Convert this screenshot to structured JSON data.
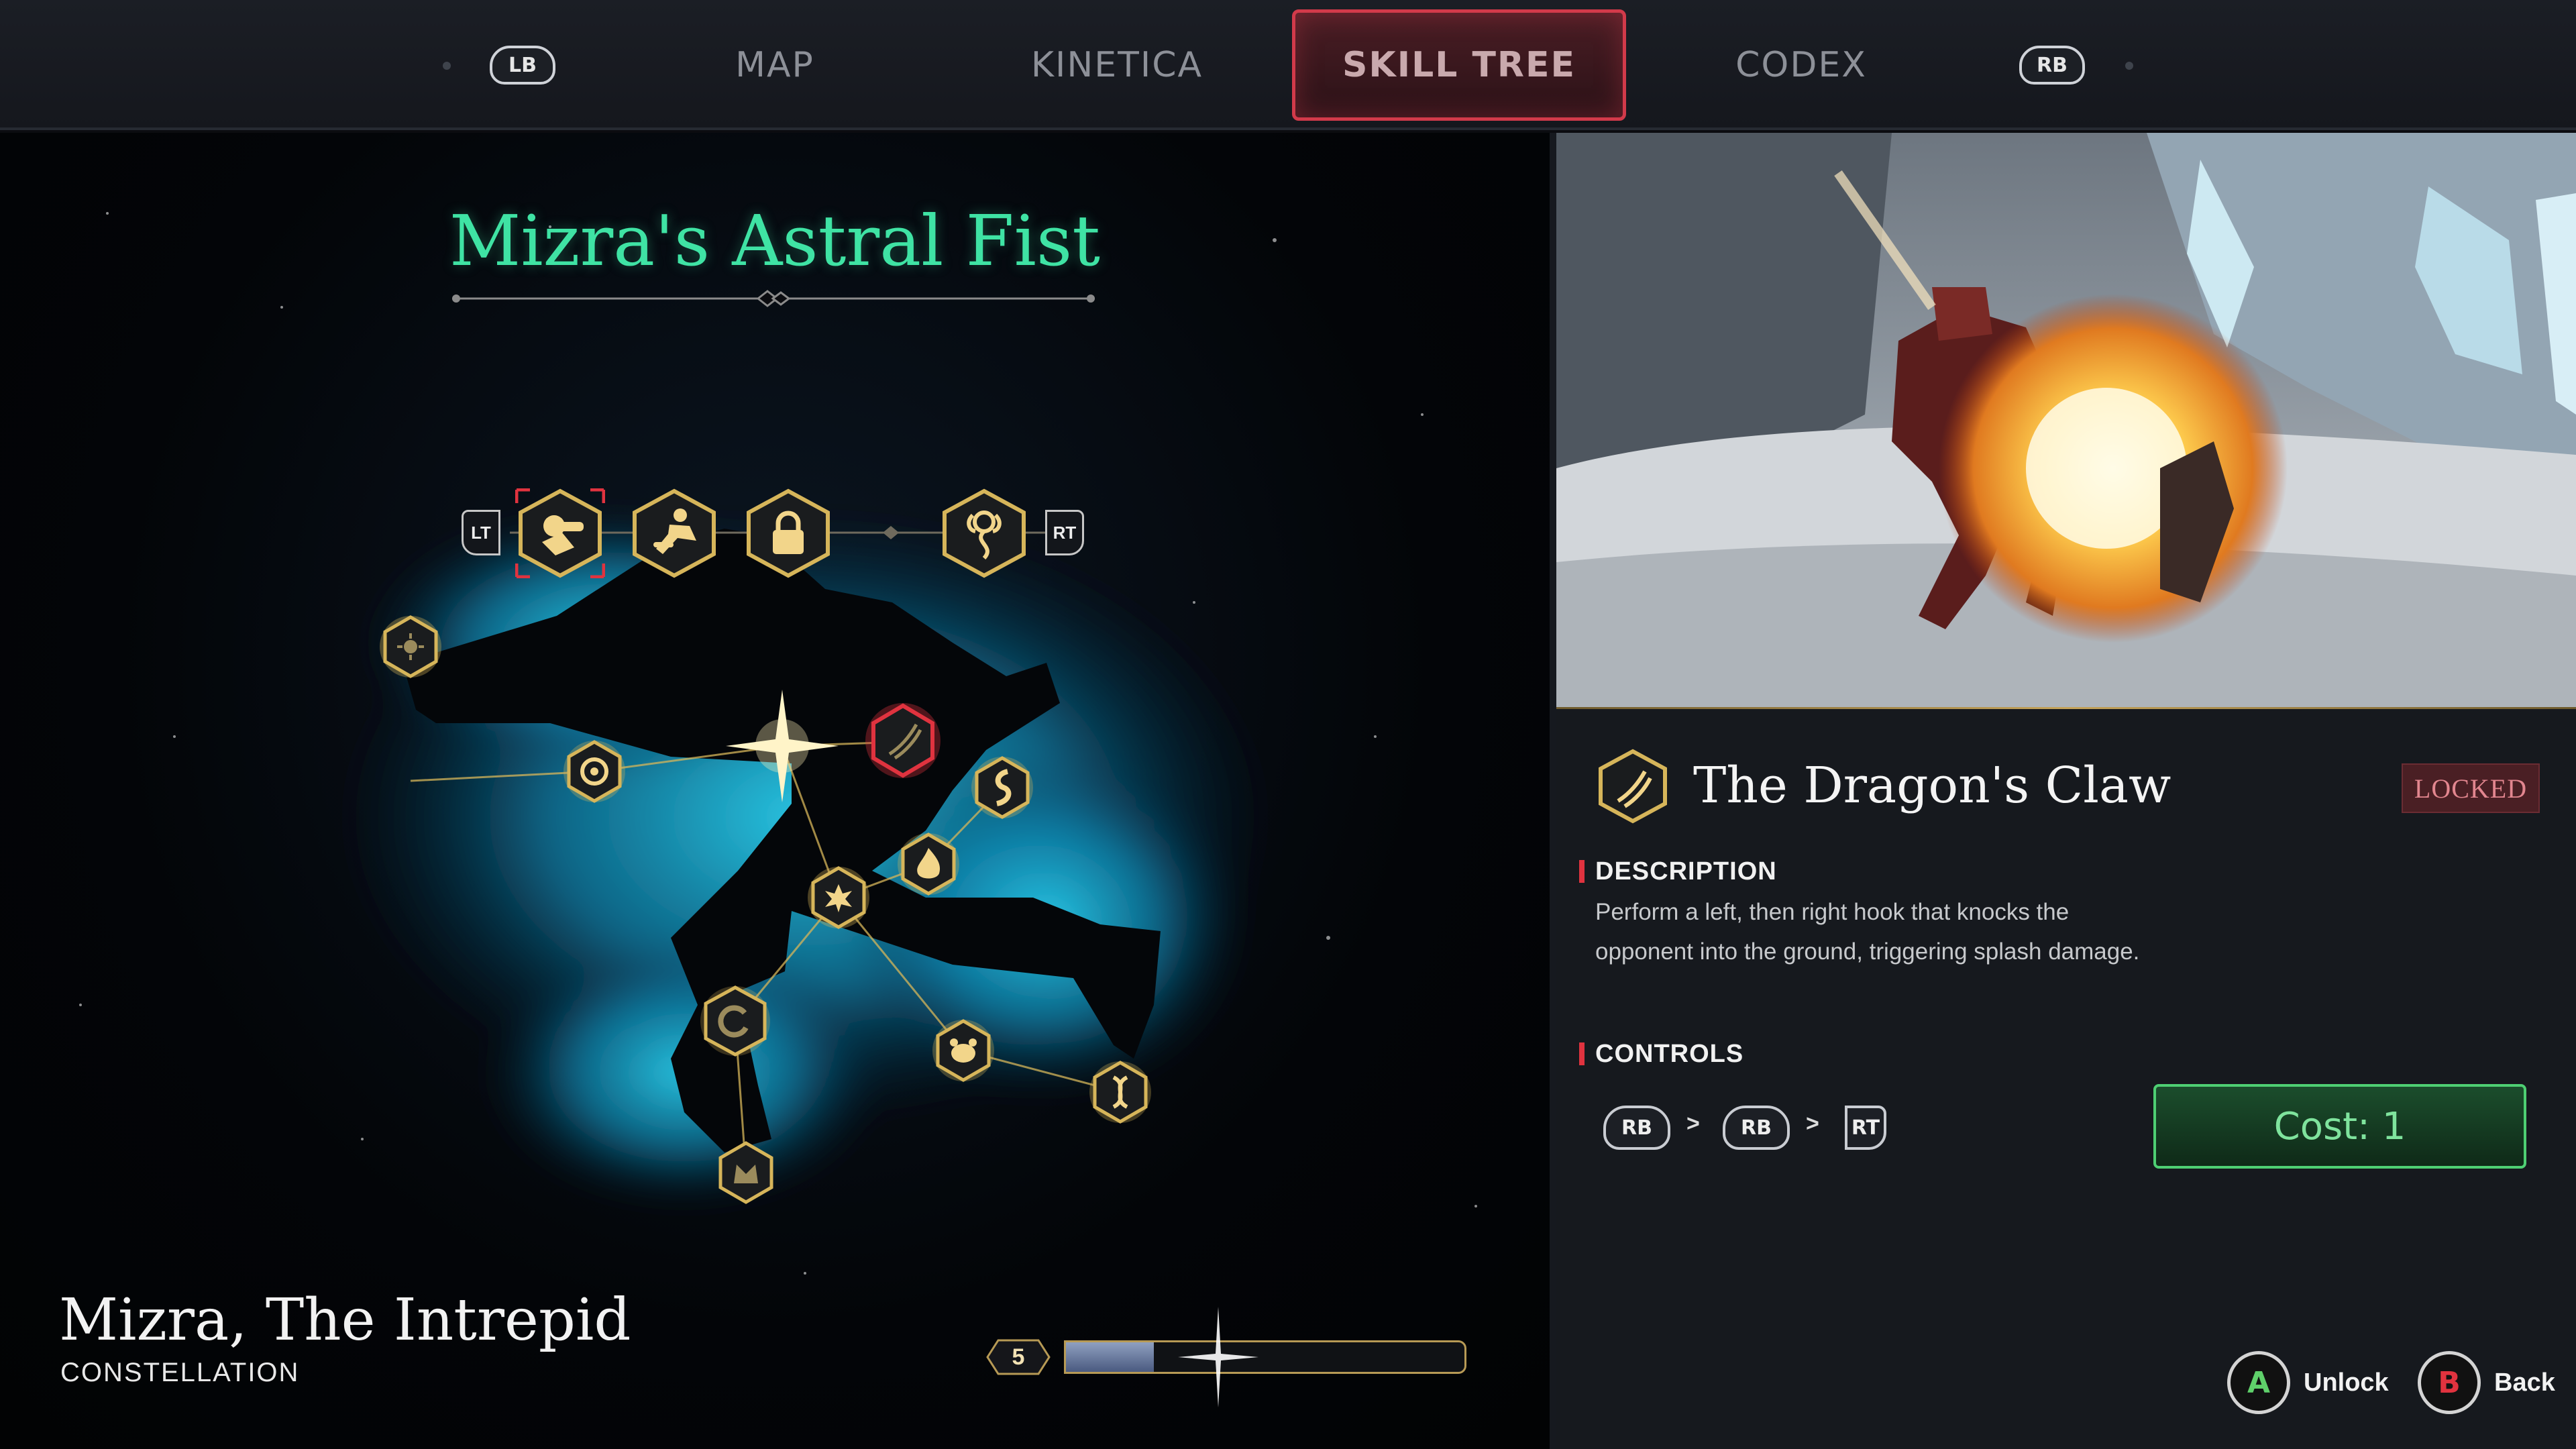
{
  "topbar": {
    "left_bumper": "LB",
    "right_bumper": "RB",
    "tabs": [
      {
        "label": "MAP"
      },
      {
        "label": "KINETICA"
      },
      {
        "label": "SKILL TREE"
      },
      {
        "label": "CODEX"
      }
    ],
    "active_tab": "SKILL TREE"
  },
  "constellation_panel": {
    "tree_title": "Mizra's Astral Fist",
    "left_trigger": "LT",
    "right_trigger": "RT",
    "tree_icons": [
      "fist-strike-icon",
      "kick-icon",
      "lock-icon",
      "spiral-glyph-icon"
    ],
    "constellation_name": "Mizra, The Intrepid",
    "constellation_label": "CONSTELLATION",
    "level": "5",
    "progress": 0.22,
    "colors": {
      "title": "#3fe3a4",
      "nebula": "#1fb8d8",
      "gold": "#d6b55a",
      "selected": "#e0333f"
    }
  },
  "skill_detail": {
    "name": "The Dragon's Claw",
    "status": "LOCKED",
    "description_heading": "DESCRIPTION",
    "description": "Perform a left, then right hook that knocks the opponent into the ground, triggering splash damage.",
    "controls_heading": "CONTROLS",
    "controls": [
      "RB",
      ">",
      "RB",
      ">",
      "RT"
    ],
    "cost": "Cost: 1"
  },
  "prompts": {
    "unlock": {
      "button": "A",
      "label": "Unlock",
      "color": "#5fd06a"
    },
    "back": {
      "button": "B",
      "label": "Back",
      "color": "#e0333f"
    }
  }
}
